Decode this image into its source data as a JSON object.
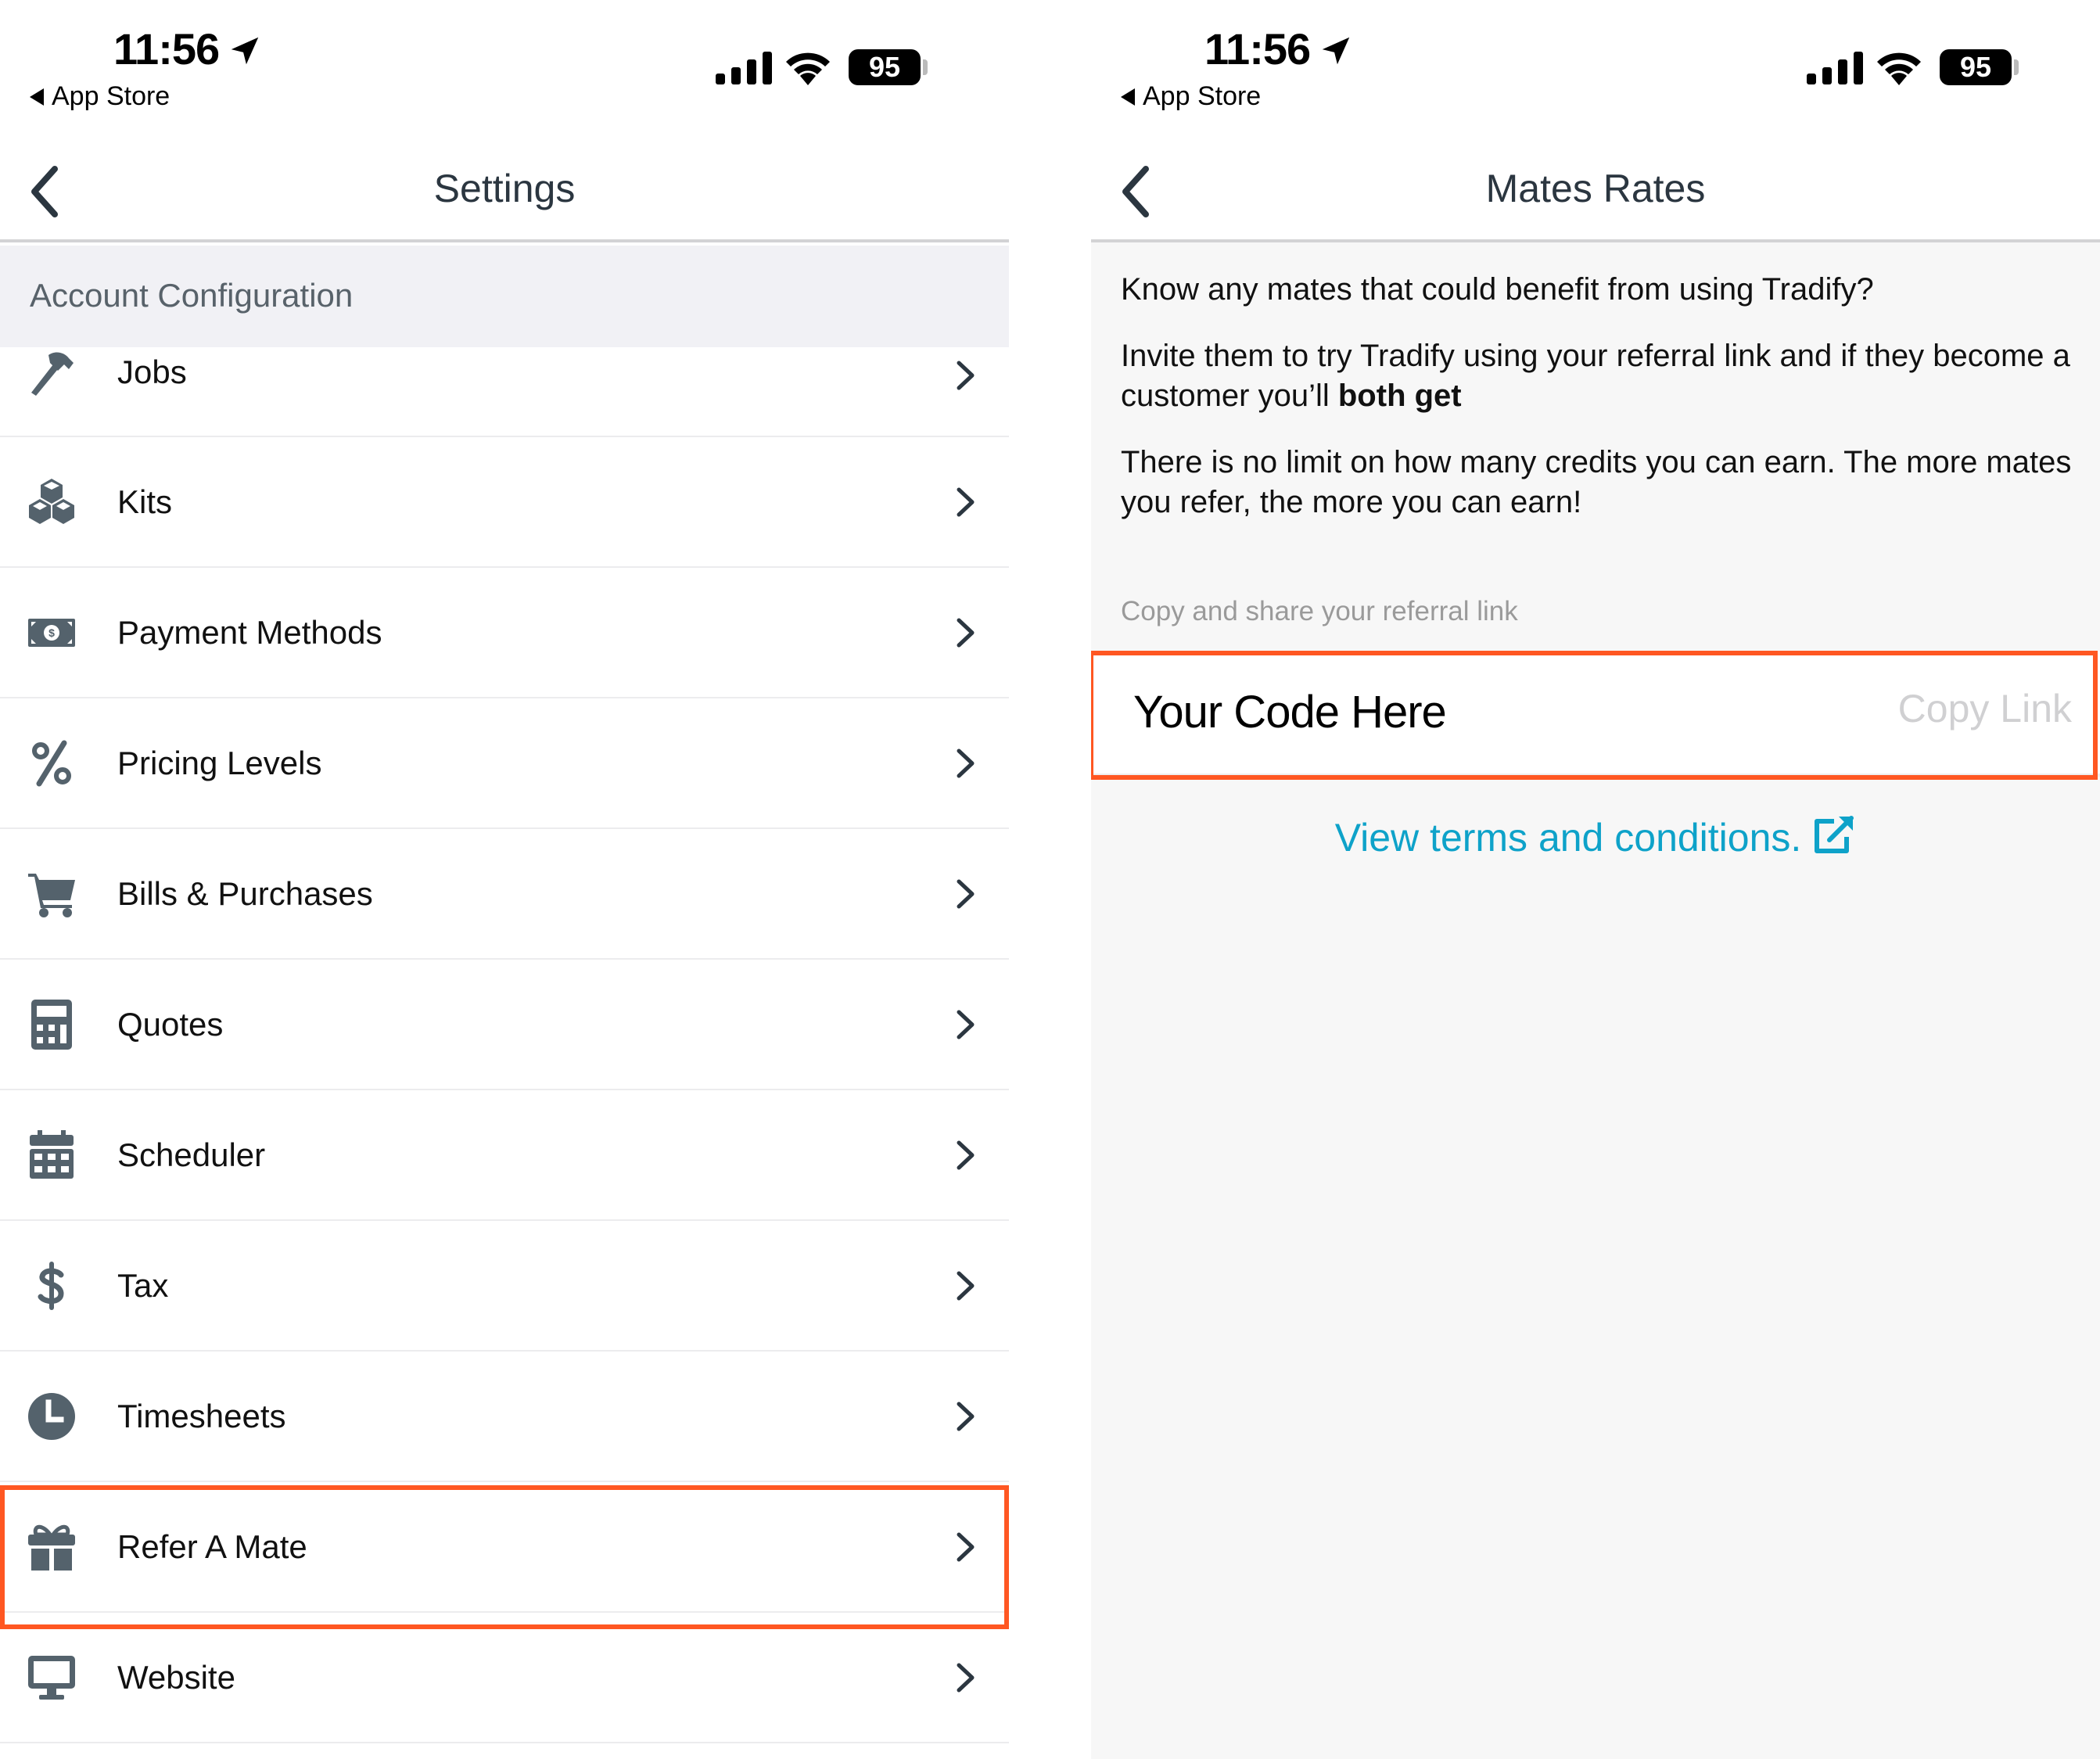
{
  "status_bar": {
    "time": "11:56",
    "back_app": "App Store",
    "battery": "95",
    "icons": [
      "location-arrow-icon",
      "signal-icon",
      "wifi-icon",
      "battery-icon"
    ]
  },
  "left_screen": {
    "title": "Settings",
    "section_header": "Account Configuration",
    "items": [
      {
        "label": "Jobs",
        "icon": "hammer-icon"
      },
      {
        "label": "Kits",
        "icon": "cubes-icon"
      },
      {
        "label": "Payment Methods",
        "icon": "money-bill-icon"
      },
      {
        "label": "Pricing Levels",
        "icon": "percent-icon"
      },
      {
        "label": "Bills & Purchases",
        "icon": "shopping-cart-icon"
      },
      {
        "label": "Quotes",
        "icon": "calculator-icon"
      },
      {
        "label": "Scheduler",
        "icon": "calendar-icon"
      },
      {
        "label": "Tax",
        "icon": "dollar-icon"
      },
      {
        "label": "Timesheets",
        "icon": "clock-icon"
      },
      {
        "label": "Refer A Mate",
        "icon": "gift-icon",
        "highlighted": true
      },
      {
        "label": "Website",
        "icon": "desktop-icon"
      }
    ]
  },
  "right_screen": {
    "title": "Mates Rates",
    "paragraph_1": "Know any mates that could benefit from using Tradify?",
    "paragraph_2_prefix": "Invite them to try Tradify using your referral link and if they become a customer you’ll ",
    "paragraph_2_bold": "both get",
    "paragraph_3": "There is no limit on how many credits you can earn. The more mates you refer, the more you can earn!",
    "share_label": "Copy and share your referral link",
    "code_value": "Your Code Here",
    "copy_link_label": "Copy Link",
    "terms_link": "View terms and conditions.",
    "terms_icon": "external-link-icon"
  },
  "colors": {
    "highlight": "#ff5722",
    "link": "#0ea2c9",
    "icon": "#54626c",
    "section_bg": "#f1f1f5"
  }
}
